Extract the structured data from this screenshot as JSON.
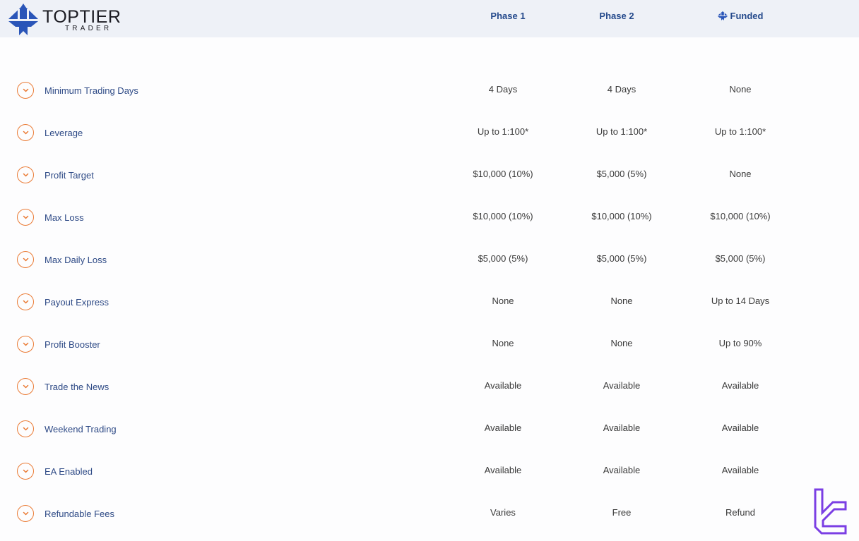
{
  "header": {
    "logo": {
      "name": "TOPTIER",
      "subtitle": "TRADER",
      "icon": "toptier-arrows-logo"
    },
    "columns": [
      {
        "label": "Phase 1",
        "icon": null
      },
      {
        "label": "Phase 2",
        "icon": null
      },
      {
        "label": "Funded",
        "icon": "toptier-mini-logo-icon"
      }
    ]
  },
  "colors": {
    "header_bg": "#eef1f7",
    "accent_orange": "#ea7b35",
    "label_blue": "#2e4a86",
    "heading_blue": "#254a8c",
    "logo_blue": "#2a55b8",
    "watermark_purple": "#7b3fe4"
  },
  "rows": [
    {
      "label": "Minimum Trading Days",
      "values": [
        "4 Days",
        "4 Days",
        "None"
      ]
    },
    {
      "label": "Leverage",
      "values": [
        "Up to 1:100*",
        "Up to 1:100*",
        "Up to 1:100*"
      ]
    },
    {
      "label": "Profit Target",
      "values": [
        "$10,000 (10%)",
        "$5,000 (5%)",
        "None"
      ]
    },
    {
      "label": "Max Loss",
      "values": [
        "$10,000 (10%)",
        "$10,000 (10%)",
        "$10,000 (10%)"
      ]
    },
    {
      "label": "Max Daily Loss",
      "values": [
        "$5,000 (5%)",
        "$5,000 (5%)",
        "$5,000 (5%)"
      ]
    },
    {
      "label": "Payout Express",
      "values": [
        "None",
        "None",
        "Up to 14 Days"
      ]
    },
    {
      "label": "Profit Booster",
      "values": [
        "None",
        "None",
        "Up to 90%"
      ]
    },
    {
      "label": "Trade the News",
      "values": [
        "Available",
        "Available",
        "Available"
      ]
    },
    {
      "label": "Weekend Trading",
      "values": [
        "Available",
        "Available",
        "Available"
      ]
    },
    {
      "label": "EA Enabled",
      "values": [
        "Available",
        "Available",
        "Available"
      ]
    },
    {
      "label": "Refundable Fees",
      "values": [
        "Varies",
        "Free",
        "Refund"
      ]
    }
  ],
  "watermark": {
    "icon": "tradingfinder-logo"
  }
}
